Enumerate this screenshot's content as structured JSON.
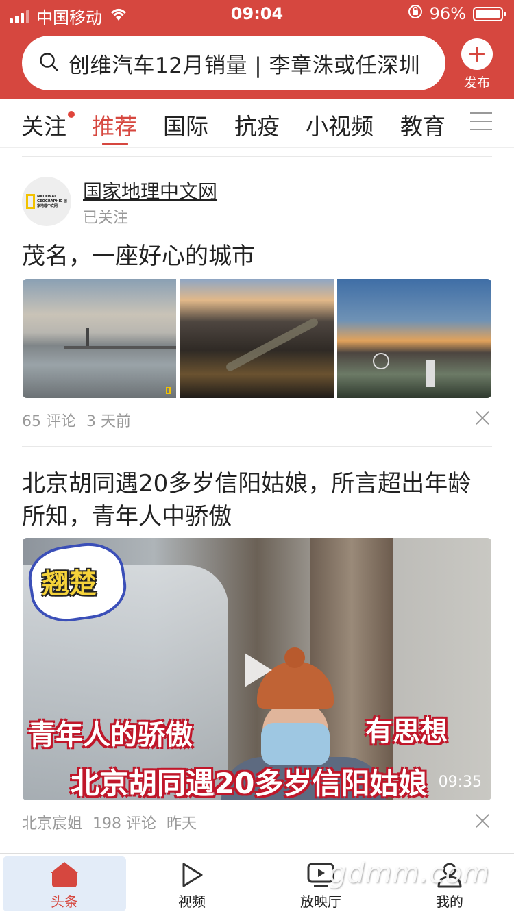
{
  "status_bar": {
    "carrier": "中国移动",
    "time": "09:04",
    "battery_percent": "96%",
    "battery_level": 0.96,
    "icons": [
      "signal-icon",
      "wifi-icon",
      "rotation-lock-icon",
      "battery-icon"
    ]
  },
  "search": {
    "text": "创维汽车12月销量 | 李章洙或任深圳",
    "icon": "search-icon"
  },
  "publish": {
    "label": "发布",
    "icon": "plus-icon"
  },
  "tabs": [
    {
      "label": "关注",
      "has_dot": true
    },
    {
      "label": "推荐",
      "active": true
    },
    {
      "label": "国际"
    },
    {
      "label": "抗疫"
    },
    {
      "label": "小视频"
    },
    {
      "label": "教育"
    }
  ],
  "feed": {
    "article1": {
      "publisher": "国家地理中文网",
      "follow_status": "已关注",
      "logo_text": "NATIONAL GEOGRAPHIC 国家地理中文网",
      "title": "茂名，一座好心的城市",
      "comments": "65 评论",
      "time": "3 天前"
    },
    "article2": {
      "title": "北京胡同遇20多岁信阳姑娘，所言超出年龄所知，青年人中骄傲",
      "video_badge": "翘楚",
      "caption_left": "青年人的骄傲",
      "caption_right": "有思想",
      "caption_bottom": "北京胡同遇20多岁信阳姑娘",
      "duration": "09:35",
      "author": "北京宸姐",
      "comments": "198 评论",
      "time": "昨天"
    }
  },
  "bottom_nav": [
    {
      "label": "头条",
      "icon": "home-icon",
      "active": true
    },
    {
      "label": "视频",
      "icon": "play-icon"
    },
    {
      "label": "放映厅",
      "icon": "tv-icon"
    },
    {
      "label": "我的",
      "icon": "user-icon"
    }
  ],
  "watermark": "gdmm.com",
  "colors": {
    "accent": "#d6473f",
    "muted": "#999999"
  }
}
